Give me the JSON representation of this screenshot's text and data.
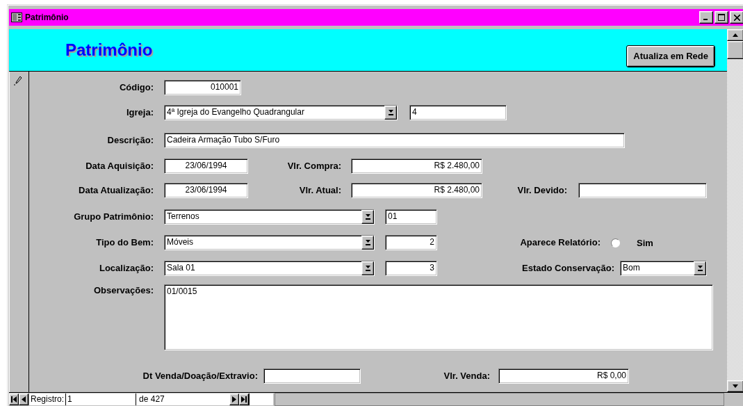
{
  "window": {
    "title": "Patrimônio"
  },
  "header": {
    "title": "Patrimônio",
    "button": "Atualiza em Rede"
  },
  "rows": [
    [
      {
        "kind": "text",
        "label": "Código:",
        "value": "010001"
      }
    ],
    [
      {
        "kind": "combo",
        "label": "Igreja:",
        "value": "4ª Igreja do Evangelho Quadrangular"
      },
      {
        "kind": "text",
        "value": "4"
      }
    ],
    [
      {
        "kind": "text",
        "label": "Descrição:",
        "value": "Cadeira Armação Tubo S/Furo"
      }
    ],
    [
      {
        "kind": "text",
        "label": "Data Aquisição:",
        "value": "23/06/1994"
      },
      {
        "kind": "text",
        "label": "Vlr. Compra:",
        "value": "R$ 2.480,00"
      }
    ],
    [
      {
        "kind": "text",
        "label": "Data Atualização:",
        "value": "23/06/1994"
      },
      {
        "kind": "text",
        "label": "Vlr. Atual:",
        "value": "R$ 2.480,00"
      },
      {
        "kind": "text",
        "label": "Vlr. Devido:"
      }
    ],
    [
      {
        "kind": "combo",
        "label": "Grupo Patrimônio:",
        "value": "Terrenos"
      },
      {
        "kind": "text",
        "value": "01"
      }
    ],
    [
      {
        "kind": "combo",
        "label": "Tipo do Bem:",
        "value": "Móveis"
      },
      {
        "kind": "text",
        "value": "2"
      },
      {
        "kind": "radio",
        "label": "Aparece Relatório:",
        "option": "Sim",
        "checked": false
      }
    ],
    [
      {
        "kind": "combo",
        "label": "Localização:",
        "value": "Sala 01"
      },
      {
        "kind": "text",
        "value": "3"
      },
      {
        "kind": "combo",
        "label": "Estado Conservação:",
        "value": "Bom"
      }
    ],
    [
      {
        "kind": "memo",
        "label": "Observações:",
        "value": "01/0015"
      }
    ],
    [
      {
        "kind": "text",
        "label": "Dt Venda/Doação/Extravio:"
      },
      {
        "kind": "text",
        "label": "Vlr. Venda:",
        "value": "R$ 0,00"
      }
    ]
  ],
  "navigation": {
    "label": "Registro:",
    "record": "1",
    "total": "de 427"
  }
}
